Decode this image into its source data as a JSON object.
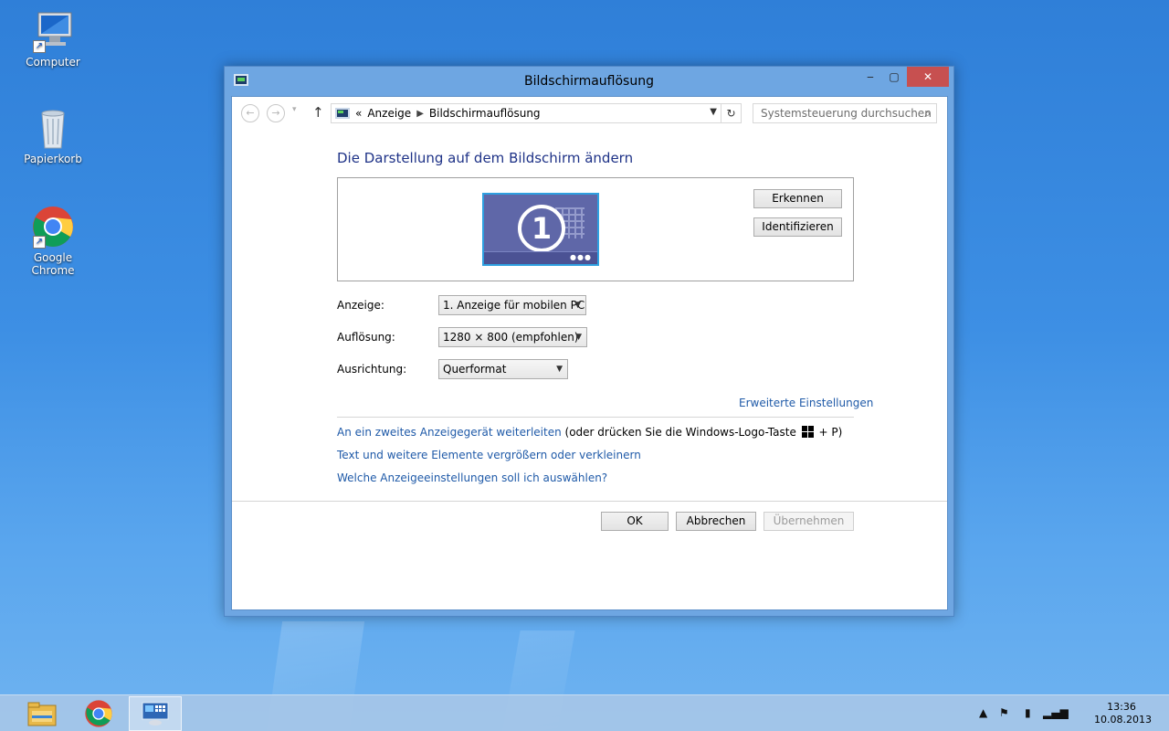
{
  "desktop": {
    "icons": [
      {
        "label": "Computer",
        "icon": "computer-icon"
      },
      {
        "label": "Papierkorb",
        "icon": "recycle-bin-icon"
      },
      {
        "label": "Google Chrome",
        "icon": "chrome-icon"
      }
    ]
  },
  "window": {
    "title": "Bildschirmauflösung",
    "controls": {
      "minimize": "‒",
      "maximize": "▢",
      "close": "✕"
    },
    "nav": {
      "back": "←",
      "forward": "→",
      "recent": "▾",
      "up": "↑",
      "breadcrumb_overflow": "«",
      "breadcrumb": [
        "Anzeige",
        "Bildschirmauflösung"
      ],
      "refresh": "↻",
      "search_placeholder": "Systemsteuerung durchsuchen"
    },
    "heading": "Die Darstellung auf dem Bildschirm ändern",
    "preview": {
      "monitor_number": "1",
      "detect_button": "Erkennen",
      "identify_button": "Identifizieren"
    },
    "settings": {
      "display_label": "Anzeige:",
      "display_value": "1. Anzeige für mobilen PC",
      "resolution_label": "Auflösung:",
      "resolution_value": "1280 × 800 (empfohlen)",
      "orientation_label": "Ausrichtung:",
      "orientation_value": "Querformat"
    },
    "advanced_link": "Erweiterte Einstellungen",
    "links": {
      "project_link": "An ein zweites Anzeigegerät weiterleiten",
      "project_hint_prefix": "(oder drücken Sie die Windows-Logo-Taste",
      "project_hint_suffix": "+ P)",
      "textsize_link": "Text und weitere Elemente vergrößern oder verkleinern",
      "help_link": "Welche Anzeigeeinstellungen soll ich auswählen?"
    },
    "footer": {
      "ok": "OK",
      "cancel": "Abbrechen",
      "apply": "Übernehmen"
    }
  },
  "taskbar": {
    "items": [
      "file-explorer-icon",
      "chrome-icon",
      "display-settings-icon"
    ],
    "clock_time": "13:36",
    "clock_date": "10.08.2013"
  }
}
